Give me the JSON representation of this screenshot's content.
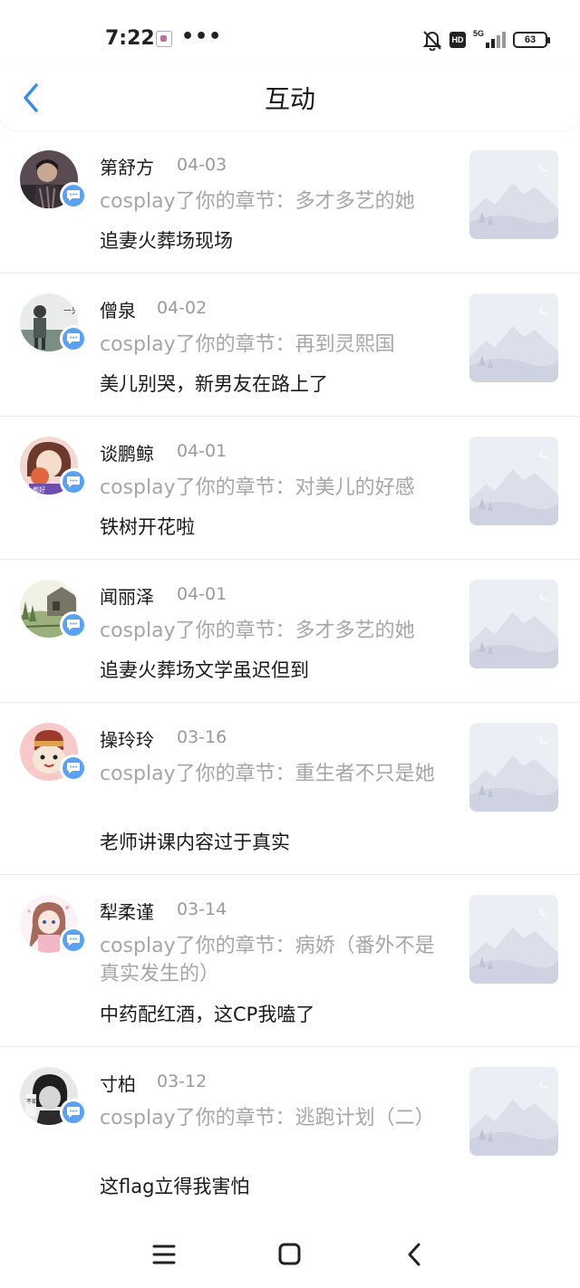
{
  "status_bar": {
    "time": "7:22",
    "more": "•••",
    "network": "5G",
    "hd": "HD",
    "battery": "63"
  },
  "header": {
    "title": "互动",
    "back_icon": "chevron-left-icon",
    "accent_color": "#3a8ee6"
  },
  "items": [
    {
      "name": "第舒方",
      "date": "04-03",
      "chapter": "cosplay了你的章节：多才多艺的她",
      "comment": "追妻火葬场现场"
    },
    {
      "name": "僧泉",
      "date": "04-02",
      "chapter": "cosplay了你的章节：再到灵熙国",
      "comment": "美儿别哭，新男友在路上了"
    },
    {
      "name": "谈鹏鲸",
      "date": "04-01",
      "chapter": "cosplay了你的章节：对美儿的好感",
      "comment": "铁树开花啦"
    },
    {
      "name": "闻丽泽",
      "date": "04-01",
      "chapter": "cosplay了你的章节：多才多艺的她",
      "comment": "追妻火葬场文学虽迟但到"
    },
    {
      "name": "操玲玲",
      "date": "03-16",
      "chapter": "cosplay了你的章节：重生者不只是她",
      "comment": "老师讲课内容过于真实"
    },
    {
      "name": "犁柔谨",
      "date": "03-14",
      "chapter": "cosplay了你的章节：病娇（番外不是真实发生的）",
      "comment": "中药配红酒，这CP我嗑了"
    },
    {
      "name": "寸柏",
      "date": "03-12",
      "chapter": "cosplay了你的章节：逃跑计划（二）",
      "comment": "这flag立得我害怕"
    }
  ],
  "avatar_text": {
    "one": "一只",
    "two": "都好",
    "three": "不如"
  },
  "nav": {
    "menu_icon": "menu-icon",
    "home_icon": "home-square-icon",
    "back_icon": "back-triangle-icon"
  },
  "colors": {
    "badge": "#5aa2f0",
    "secondary_text": "#a6a6a6",
    "date_text": "#9a9a9a"
  }
}
